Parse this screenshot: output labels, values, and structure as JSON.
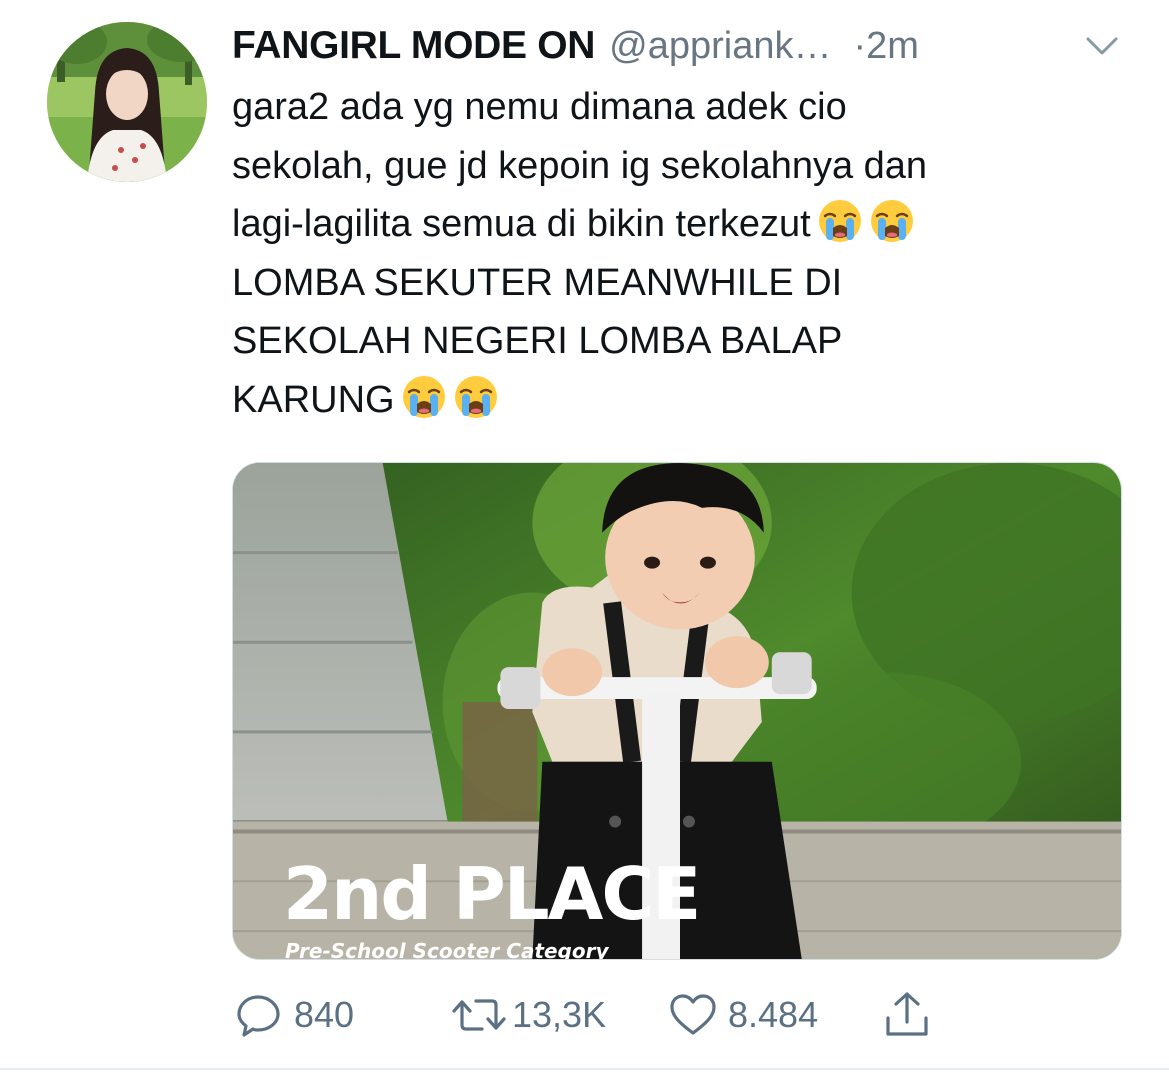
{
  "tweet": {
    "author_name": "FANGIRL MODE ON",
    "author_handle": "@appriank…",
    "timestamp": "·2m",
    "text_lines": [
      "gara2 ada yg nemu dimana adek cio",
      "sekolah, gue jd kepoin ig sekolahnya dan",
      "lagi-lagilita semua di bikin terkezut",
      "LOMBA SEKUTER MEANWHILE DI",
      "SEKOLAH NEGERI LOMBA BALAP",
      "KARUNG"
    ],
    "emoji_name": "loudly-crying-face",
    "media": {
      "title": "2nd PLACE",
      "subtitle": "Pre-School Scooter Category"
    },
    "actions": {
      "replies": "840",
      "retweets": "13,3K",
      "likes": "8.484"
    }
  },
  "colors": {
    "text": "#0f1419",
    "secondary": "#687684",
    "icon": "#5b7083",
    "divider": "#e6ecf0"
  },
  "icons": {
    "reply": "speech-bubble-icon",
    "retweet": "retweet-arrows-icon",
    "like": "heart-icon",
    "share": "share-upload-icon",
    "menu": "chevron-down-icon"
  }
}
